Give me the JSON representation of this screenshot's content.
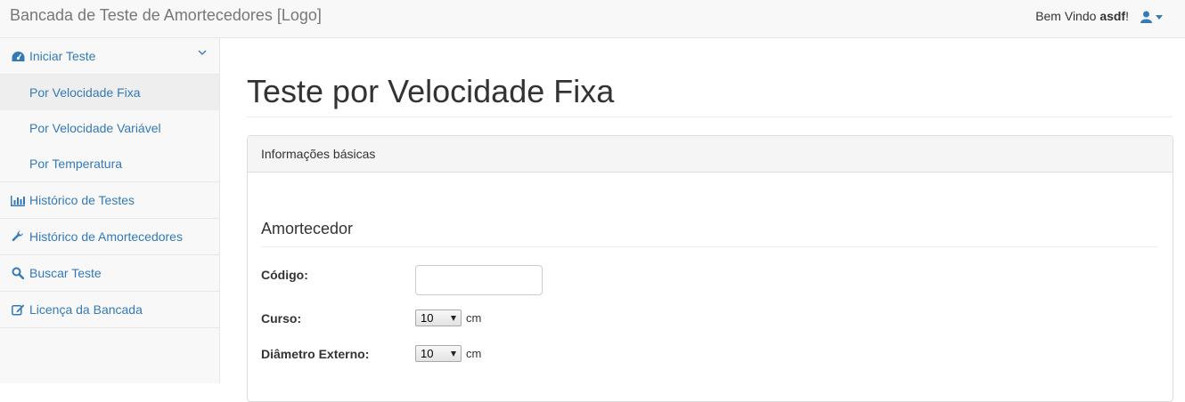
{
  "navbar": {
    "brand": "Bancada de Teste de Amortecedores [Logo]",
    "welcome_prefix": "Bem Vindo ",
    "username": "asdf",
    "welcome_suffix": "!",
    "user_icon": "user-icon"
  },
  "sidebar": {
    "start": {
      "label": "Iniciar Teste",
      "icon": "dashboard-icon"
    },
    "sub_items": [
      {
        "label": "Por Velocidade Fixa",
        "active": true
      },
      {
        "label": "Por Velocidade Variável",
        "active": false
      },
      {
        "label": "Por Temperatura",
        "active": false
      }
    ],
    "items": [
      {
        "label": "Histórico de Testes",
        "icon": "bar-chart-icon"
      },
      {
        "label": "Histórico de Amortecedores",
        "icon": "wrench-icon"
      },
      {
        "label": "Buscar Teste",
        "icon": "search-icon"
      },
      {
        "label": "Licença da Bancada",
        "icon": "edit-icon"
      }
    ]
  },
  "main": {
    "title": "Teste por Velocidade Fixa",
    "panel": {
      "heading": "Informações básicas",
      "section": "Amortecedor",
      "fields": {
        "codigo": {
          "label": "Código:",
          "value": ""
        },
        "curso": {
          "label": "Curso:",
          "value": "10",
          "unit": "cm"
        },
        "diametro": {
          "label": "Diâmetro Externo:",
          "value": "10",
          "unit": "cm"
        }
      }
    }
  },
  "colors": {
    "link": "#337ab7",
    "navbar_bg": "#f8f8f8",
    "active_bg": "#eeeeee"
  }
}
